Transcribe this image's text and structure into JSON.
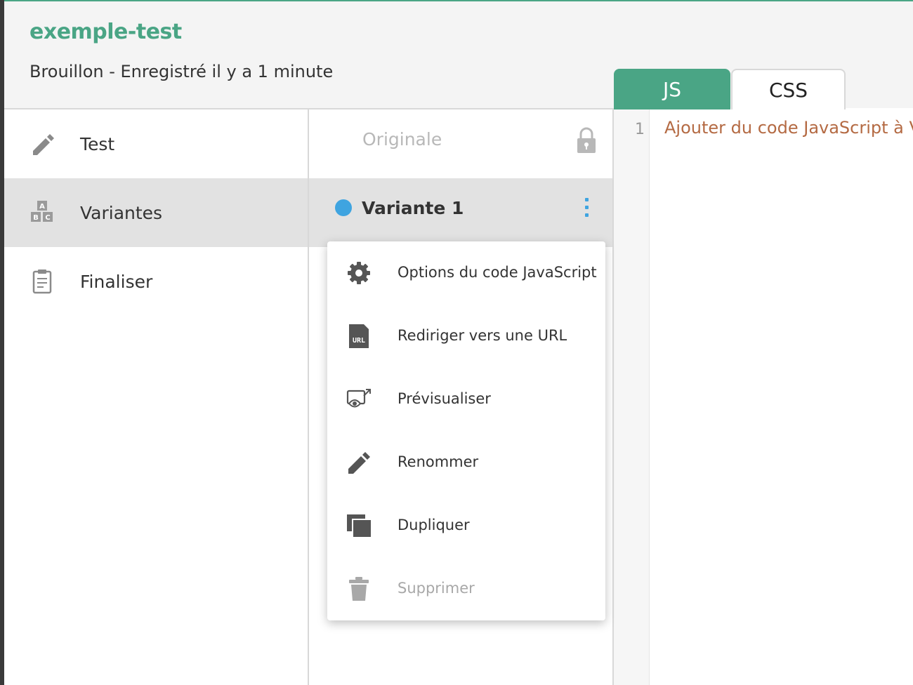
{
  "header": {
    "title": "exemple-test",
    "status": "Brouillon - Enregistré il y a 1 minute"
  },
  "tabs": [
    {
      "label": "JS",
      "active": true
    },
    {
      "label": "CSS",
      "active": false
    }
  ],
  "sidebar": {
    "items": [
      {
        "label": "Test",
        "icon": "pencil-icon",
        "active": false
      },
      {
        "label": "Variantes",
        "icon": "abc-blocks-icon",
        "active": true
      },
      {
        "label": "Finaliser",
        "icon": "clipboard-icon",
        "active": false
      }
    ]
  },
  "variants": {
    "original": {
      "label": "Originale",
      "icon": "lock-icon"
    },
    "variant1": {
      "label": "Variante 1",
      "color": "#3fa4e0",
      "menu_icon": "kebab-menu-icon"
    }
  },
  "editor": {
    "line_number": "1",
    "placeholder": "Ajouter du code JavaScript à Va"
  },
  "context_menu": {
    "items": [
      {
        "label": "Options du code JavaScript",
        "icon": "gear-icon",
        "disabled": false
      },
      {
        "label": "Rediriger vers une URL",
        "icon": "url-icon",
        "disabled": false
      },
      {
        "label": "Prévisualiser",
        "icon": "preview-icon",
        "disabled": false
      },
      {
        "label": "Renommer",
        "icon": "pencil-icon",
        "disabled": false
      },
      {
        "label": "Dupliquer",
        "icon": "duplicate-icon",
        "disabled": false
      },
      {
        "label": "Supprimer",
        "icon": "trash-icon",
        "disabled": true
      }
    ]
  },
  "colors": {
    "brand": "#4aa585",
    "variant_dot": "#3fa4e0",
    "code_text": "#b46a43"
  }
}
